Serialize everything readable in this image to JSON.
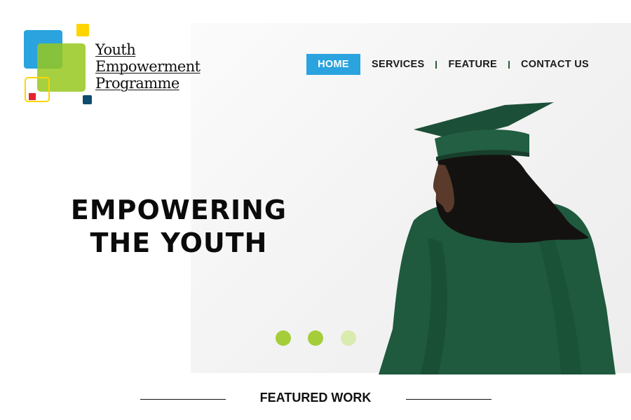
{
  "brand": {
    "line1": "Youth",
    "line2": "Empowerment",
    "line3": "Programme"
  },
  "nav": {
    "home": "HOME",
    "services": "SERVICES",
    "feature": "FEATURE",
    "contact": "CONTACT US",
    "active": "HOME"
  },
  "hero": {
    "headline_line1": "EMPOWERING",
    "headline_line2": "THE YOUTH"
  },
  "slider": {
    "dots": 3,
    "active_index": 0
  },
  "featured": {
    "title": "FEATURED WORK"
  },
  "colors": {
    "accent_blue": "#2aa3df",
    "accent_green": "#a4cd39",
    "gown_green": "#1f5a3e"
  }
}
